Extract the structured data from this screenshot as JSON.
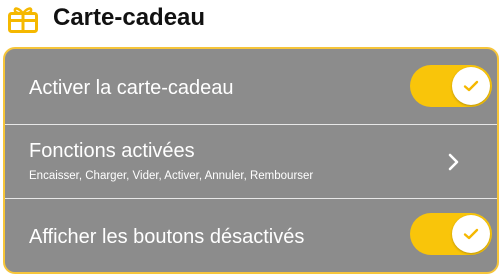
{
  "header": {
    "title": "Carte-cadeau",
    "icon": "gift-icon"
  },
  "settings": {
    "enable_gift_card": {
      "label": "Activer la carte-cadeau",
      "enabled": true
    },
    "enabled_functions": {
      "label": "Fonctions activées",
      "summary": "Encaisser, Charger, Vider, Activer, Annuler, Rembourser"
    },
    "show_disabled_buttons": {
      "label": "Afficher les boutons désactivés",
      "enabled": true
    }
  },
  "colors": {
    "accent": "#f9c50a",
    "card_background": "#8c8c8c",
    "card_border": "#f6c53a"
  }
}
